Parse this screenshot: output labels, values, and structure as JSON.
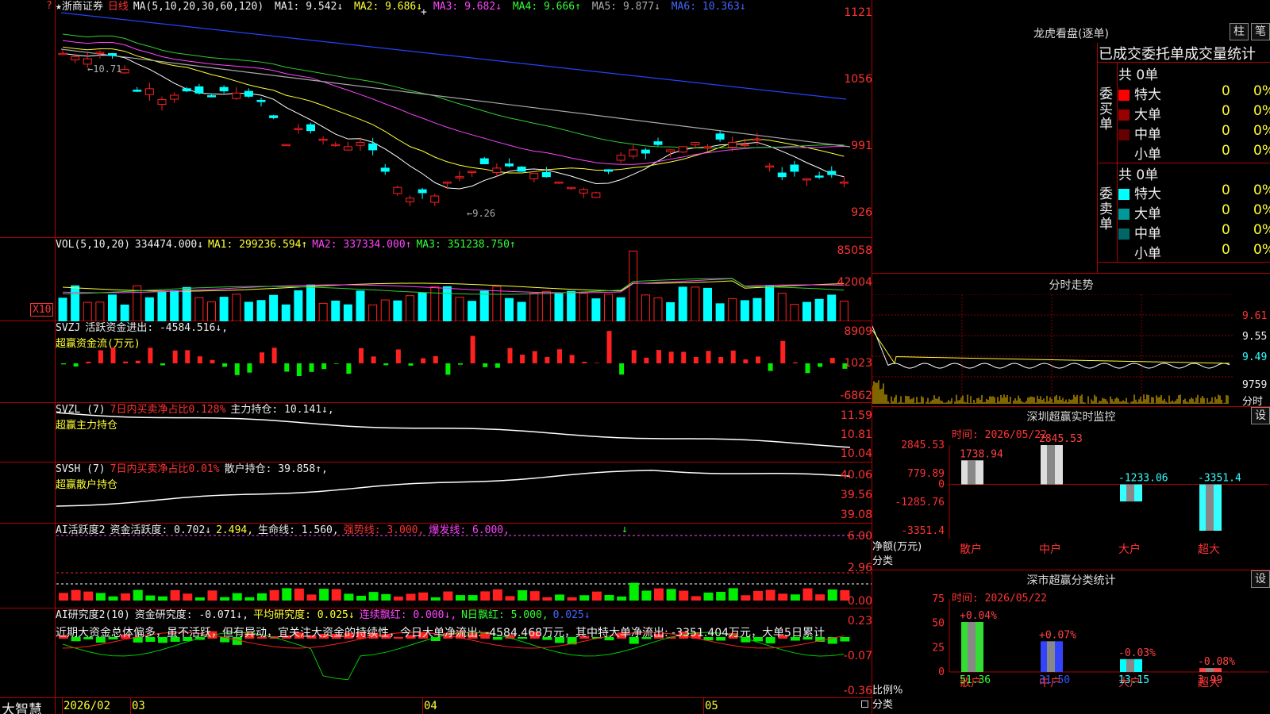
{
  "colors": {
    "up": "#ff2020",
    "down": "#00ffff",
    "grid": "#b00000",
    "ma1": "#ffffff",
    "ma2": "#ffff33",
    "ma3": "#ff44ff",
    "ma4": "#33cc33",
    "ma5": "#aaaaaa",
    "ma6": "#2244ff"
  },
  "corner_icon": "?",
  "main": {
    "stock_name": "★浙商证券",
    "period": "日线",
    "ma_label": "MA(5,10,20,30,60,120)",
    "ma": [
      {
        "name": "MA1",
        "value": "9.542↓"
      },
      {
        "name": "MA2",
        "value": "9.686↓"
      },
      {
        "name": "MA3",
        "value": "9.682↓"
      },
      {
        "name": "MA4",
        "value": "9.666↑"
      },
      {
        "name": "MA5",
        "value": "9.877↓"
      },
      {
        "name": "MA6",
        "value": "10.363↓"
      }
    ],
    "y_labels": [
      "1121",
      "1056",
      "991",
      "926"
    ],
    "high_note": "←10.71",
    "low_note": "←9.26",
    "plus_mark": "+"
  },
  "vol": {
    "label": "VOL(5,10,20)",
    "value": "334474.000↓",
    "ma": [
      {
        "name": "MA1",
        "value": "299236.594↑"
      },
      {
        "name": "MA2",
        "value": "337334.000↑"
      },
      {
        "name": "MA3",
        "value": "351238.750↑"
      }
    ],
    "y_labels": [
      "85058",
      "42004"
    ],
    "unit": "X10"
  },
  "svzj": {
    "label": "SVZJ",
    "text": "活跃资金进出: -4584.516↓,",
    "sub": "超赢资金流(万元)",
    "y_labels": [
      "8909",
      "1023",
      "-6862"
    ]
  },
  "svzl": {
    "label": "SVZL (7)",
    "t1": "7日内买卖净占比0.128%",
    "t2": "主力持仓: 10.141↓,",
    "sub": "超赢主力持仓",
    "y_labels": [
      "11.59",
      "10.81",
      "10.04"
    ]
  },
  "svsh": {
    "label": "SVSH (7)",
    "t1": "7日内买卖净占比0.01%",
    "t2": "散户持仓: 39.858↑,",
    "sub": "超赢散户持仓",
    "y_labels": [
      "40.06",
      "39.56",
      "39.08"
    ]
  },
  "ai1": {
    "label": "AI活跃度2",
    "t1": "资金活跃度: 0.702↓",
    "t2": "2.494,",
    "t3": "生命线: 1.560,",
    "t4": "强势线: 3.000,",
    "t5": "爆发线: 6.000,",
    "arrow": "↓",
    "y_labels": [
      "6.00",
      "2.96",
      "0.00"
    ]
  },
  "ai2": {
    "label": "AI研究度2(10)",
    "t1": "资金研究度: -0.071↓,",
    "t2": "平均研究度: 0.025↓",
    "t3": "连续飘红: 0.000↓,",
    "t4": "N日飘红: 5.000,",
    "t5": "0.025↓",
    "comment": "近期大资金总体偏多，虽不活跃，但有异动，宜关注大资金的持续性，今日大单净流出: -4584.468万元，其中特大单净流出: -3351.404万元，大单5日累计",
    "y_labels": [
      "0.23",
      "-0.07",
      "-0.36"
    ]
  },
  "xaxis": {
    "brand": "大智慧",
    "labels": [
      {
        "t": "2026/02"
      },
      {
        "t": "03"
      },
      {
        "t": "04"
      },
      {
        "t": "05"
      }
    ],
    "lock_icon": "🔒"
  },
  "lhb": {
    "title": "龙虎看盘(逐单)",
    "btn1": "柱",
    "btn2": "笔",
    "subtitle": "已成交委托单成交量统计",
    "buy": {
      "side": "委买单",
      "total": "共 0单",
      "rows": [
        {
          "name": "特大",
          "v": "0",
          "p": "0%"
        },
        {
          "name": "大单",
          "v": "0",
          "p": "0%"
        },
        {
          "name": "中单",
          "v": "0",
          "p": "0%"
        },
        {
          "name": "小单",
          "v": "0",
          "p": "0%"
        }
      ]
    },
    "sell": {
      "side": "委卖单",
      "total": "共 0单",
      "rows": [
        {
          "name": "特大",
          "v": "0",
          "p": "0%"
        },
        {
          "name": "大单",
          "v": "0",
          "p": "0%"
        },
        {
          "name": "中单",
          "v": "0",
          "p": "0%"
        },
        {
          "name": "小单",
          "v": "0",
          "p": "0%"
        }
      ]
    }
  },
  "fenshi": {
    "title": "分时走势",
    "y_labels": [
      "9.61",
      "9.55",
      "9.49"
    ],
    "vol_label": "9759",
    "foot": "分时"
  },
  "sz_monitor": {
    "title": "深圳超赢实时监控",
    "btn": "设",
    "time": "时间: 2026/05/22",
    "y_labels": [
      "2845.53",
      "779.89",
      "0",
      "-1285.76",
      "-3351.4"
    ],
    "ylabel": "净额(万元)",
    "xtitle": "分类",
    "chart_data": {
      "type": "bar",
      "categories": [
        "散户",
        "中户",
        "大户",
        "超大"
      ],
      "values": [
        1738.94,
        2845.53,
        -1233.06,
        -3351.4
      ],
      "value_labels": [
        "1738.94",
        "2845.53",
        "-1233.06",
        "-3351.4"
      ],
      "ylim": [
        -3351.4,
        2845.53
      ]
    }
  },
  "sz_class": {
    "title": "深市超赢分类统计",
    "btn": "设",
    "time": "时间: 2026/05/22",
    "y_labels": [
      "75",
      "50",
      "25",
      "0"
    ],
    "ylabel": "比例%",
    "xtitle": "分类",
    "chart_data": {
      "type": "bar",
      "categories": [
        "散户",
        "中户",
        "大户",
        "超大"
      ],
      "values": [
        51.36,
        31.5,
        13.15,
        3.99
      ],
      "value_labels": [
        "51.36",
        "31.50",
        "13.15",
        "3.99"
      ],
      "deltas": [
        "+0.04%",
        "+0.07%",
        "-0.03%",
        "-0.08%"
      ],
      "ylim": [
        0,
        75
      ]
    }
  }
}
